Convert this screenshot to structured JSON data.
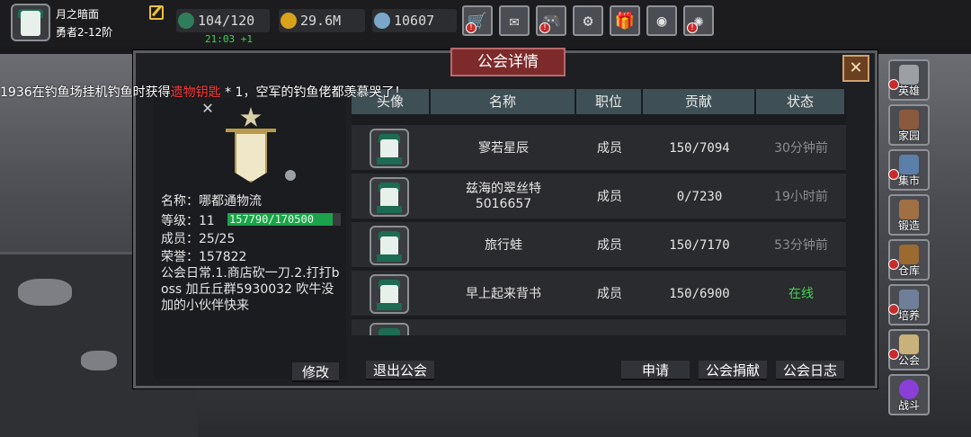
{
  "player": {
    "name": "月之暗面",
    "rank": "勇者2-12阶"
  },
  "stats": {
    "energy": "104/120",
    "energy_timer": "21:03 +1",
    "gold": "29.6M",
    "gems": "10607"
  },
  "toolbar": [
    {
      "icon": "cart-icon",
      "glyph": "🛒",
      "alert": true
    },
    {
      "icon": "mail-icon",
      "glyph": "✉",
      "alert": false
    },
    {
      "icon": "gamepad-icon",
      "glyph": "🎮",
      "alert": true
    },
    {
      "icon": "gear-icon",
      "glyph": "⚙",
      "alert": false
    },
    {
      "icon": "gift-icon",
      "glyph": "🎁",
      "alert": false
    },
    {
      "icon": "wheel-icon",
      "glyph": "◉",
      "alert": false
    },
    {
      "icon": "firework-icon",
      "glyph": "✺",
      "alert": true
    }
  ],
  "notice": {
    "prefix": "1936在钓鱼场挂机钓鱼时获得",
    "item": "遗物钥匙",
    "suffix": " * 1，空军的钓鱼佬都羡慕哭了！"
  },
  "dialog": {
    "title": "公会详情",
    "close_label": "✕"
  },
  "guild": {
    "name_label": "名称：",
    "name": "哪都通物流",
    "level_label": "等级：",
    "level": "11",
    "exp_text": "157790/170500",
    "exp_fraction": 0.925,
    "members_label": "成员：",
    "members": "25/25",
    "honor_label": "荣誉：",
    "honor": "157822",
    "announcement": "公会日常.1.商店砍一刀.2.打打boss  加丘丘群5930032 吹牛没加的小伙伴快来",
    "edit_label": "修改",
    "leave_label": "退出公会"
  },
  "table": {
    "headers": [
      "头像",
      "名称",
      "职位",
      "贡献",
      "状态"
    ],
    "rows": [
      {
        "name": "寥若星辰",
        "role": "成员",
        "contrib": "150/7094",
        "status": "30分钟前",
        "online": false
      },
      {
        "name": "兹海的翠丝特\n5016657",
        "role": "成员",
        "contrib": "0/7230",
        "status": "19小时前",
        "online": false
      },
      {
        "name": "旅行蛙",
        "role": "成员",
        "contrib": "150/7170",
        "status": "53分钟前",
        "online": false
      },
      {
        "name": "早上起来背书",
        "role": "成员",
        "contrib": "150/6900",
        "status": "在线",
        "online": true
      }
    ]
  },
  "actions": {
    "apply": "申请",
    "donate": "公会捐献",
    "log": "公会日志"
  },
  "side_menu": [
    {
      "label": "英雄",
      "icon": "helmet-icon",
      "color": "#9c9fa4",
      "alert": true
    },
    {
      "label": "家园",
      "icon": "castle-icon",
      "color": "#8b5a3c",
      "alert": false
    },
    {
      "label": "集市",
      "icon": "market-icon",
      "color": "#5b7fa8",
      "alert": true
    },
    {
      "label": "锻造",
      "icon": "anvil-icon",
      "color": "#a07044",
      "alert": false
    },
    {
      "label": "仓库",
      "icon": "chest-icon",
      "color": "#9a6a30",
      "alert": true
    },
    {
      "label": "培养",
      "icon": "sword-icon",
      "color": "#6f7f9a",
      "alert": true
    },
    {
      "label": "公会",
      "icon": "guild-icon",
      "color": "#c9b27a",
      "alert": true
    },
    {
      "label": "战斗",
      "icon": "portal-icon",
      "color": "#8a3fd6",
      "alert": false
    }
  ]
}
